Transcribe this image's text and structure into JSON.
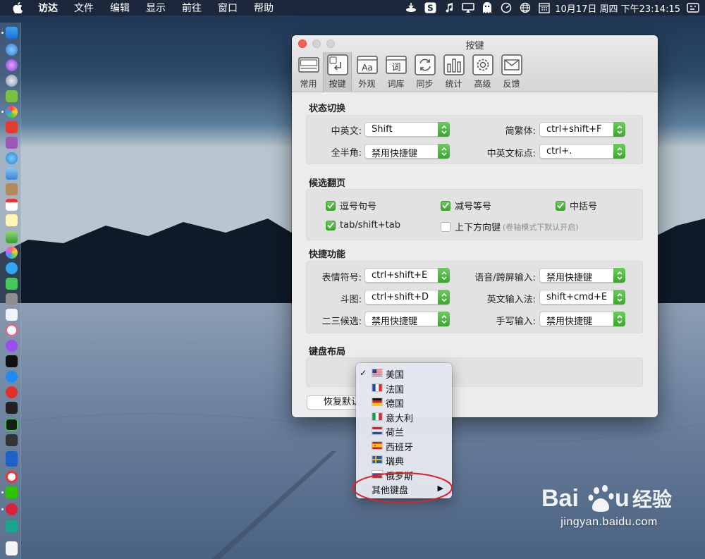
{
  "menubar": {
    "items": [
      "访达",
      "文件",
      "编辑",
      "显示",
      "前往",
      "窗口",
      "帮助"
    ],
    "clock": "10月17日 周四 下午23:14:15"
  },
  "window": {
    "title": "按键",
    "tabs": [
      {
        "label": "常用",
        "icon": "general-icon"
      },
      {
        "label": "按键",
        "icon": "keys-icon"
      },
      {
        "label": "外观",
        "icon": "appearance-icon"
      },
      {
        "label": "词库",
        "icon": "dictionary-icon"
      },
      {
        "label": "同步",
        "icon": "sync-icon"
      },
      {
        "label": "统计",
        "icon": "stats-icon"
      },
      {
        "label": "高级",
        "icon": "advanced-icon"
      },
      {
        "label": "反馈",
        "icon": "feedback-icon"
      }
    ],
    "active_tab": 1,
    "state_switch": {
      "title": "状态切换",
      "fields": [
        {
          "label": "中英文:",
          "value": "Shift"
        },
        {
          "label": "简繁体:",
          "value": "ctrl+shift+F"
        },
        {
          "label": "全半角:",
          "value": "禁用快捷键"
        },
        {
          "label": "中英文标点:",
          "value": "ctrl+."
        }
      ]
    },
    "paging": {
      "title": "候选翻页",
      "options": [
        {
          "label": "逗号句号",
          "checked": true
        },
        {
          "label": "减号等号",
          "checked": true
        },
        {
          "label": "中括号",
          "checked": true
        },
        {
          "label": "tab/shift+tab",
          "checked": true
        },
        {
          "label": "上下方向键",
          "checked": false,
          "hint": "(卷轴模式下默认开启)"
        }
      ]
    },
    "shortcuts": {
      "title": "快捷功能",
      "fields": [
        {
          "label": "表情符号:",
          "value": "ctrl+shift+E"
        },
        {
          "label": "语音/跨屏输入:",
          "value": "禁用快捷键"
        },
        {
          "label": "斗图:",
          "value": "ctrl+shift+D"
        },
        {
          "label": "英文输入法:",
          "value": "shift+cmd+E"
        },
        {
          "label": "二三候选:",
          "value": "禁用快捷键"
        },
        {
          "label": "手写输入:",
          "value": "禁用快捷键"
        }
      ]
    },
    "keyboard_layout": {
      "title": "键盘布局"
    },
    "reset_button": "恢复默认"
  },
  "dropdown": {
    "items": [
      {
        "label": "美国",
        "flag": "us-flag-icon",
        "checked": true
      },
      {
        "label": "法国",
        "flag": "fr-flag-icon",
        "checked": false
      },
      {
        "label": "德国",
        "flag": "de-flag-icon",
        "checked": false
      },
      {
        "label": "意大利",
        "flag": "it-flag-icon",
        "checked": false
      },
      {
        "label": "荷兰",
        "flag": "nl-flag-icon",
        "checked": false
      },
      {
        "label": "西班牙",
        "flag": "es-flag-icon",
        "checked": false
      },
      {
        "label": "瑞典",
        "flag": "se-flag-icon",
        "checked": false
      },
      {
        "label": "俄罗斯",
        "flag": "ru-flag-icon",
        "checked": false
      }
    ],
    "other": "其他键盘",
    "submenu_arrow": "▶",
    "checkmark": "✓"
  },
  "watermark": {
    "url": "jingyan.baidu.com"
  },
  "colors": {
    "accent_green": "#4cb83c",
    "close_red": "#fd5f57",
    "annotation_red": "#e0202a"
  }
}
